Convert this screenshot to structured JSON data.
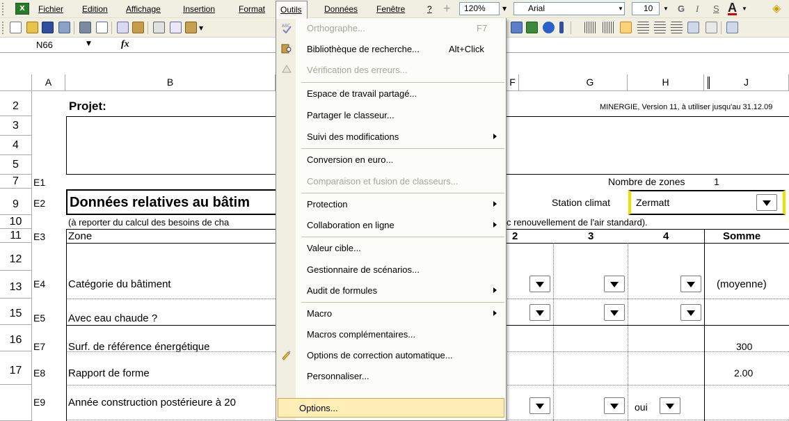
{
  "menubar": {
    "items": [
      "Fichier",
      "Edition",
      "Affichage",
      "Insertion",
      "Format",
      "Outils",
      "Données",
      "Fenêtre",
      "?"
    ],
    "zoom": "120%",
    "font_name": "Arial",
    "font_size": "10",
    "bold": "G",
    "italic": "I",
    "underline": "S"
  },
  "formula_bar": {
    "cell_ref": "N66",
    "fx": "fx"
  },
  "columns": [
    "A",
    "B",
    "F",
    "G",
    "H",
    "J"
  ],
  "rows": [
    "2",
    "3",
    "4",
    "5",
    "7",
    "9",
    "10",
    "11",
    "12",
    "13",
    "15",
    "16",
    "17"
  ],
  "sheet": {
    "project_label": "Projet:",
    "minergie": "MINERGIE, Version 11, à utiliser jusqu'au 31.12.09",
    "e1": "E1",
    "zones_label": "Nombre de zones",
    "zones_value": "1",
    "e2": "E2",
    "section_title": "Données relatives au bâtim",
    "station_label": "Station climat",
    "station_value": "Zermatt",
    "note_left": "(à reporter du calcul des besoins de cha",
    "note_right": "c renouvellement de l'air standard).",
    "e3": "E3",
    "zone_label": "Zone",
    "col2": "2",
    "col3": "3",
    "col4": "4",
    "sum": "Somme",
    "e4": "E4",
    "categorie": "Catégorie du bâtiment",
    "moyenne": "(moyenne)",
    "e5": "E5",
    "eau_chaude": "Avec eau chaude ?",
    "e7": "E7",
    "surf": "Surf. de référence énergétique",
    "surf_value": "300",
    "e8": "E8",
    "rapport": "Rapport de forme",
    "rapport_value": "2.00",
    "e9": "E9",
    "annee": "Année construction postérieure à 20",
    "oui": "oui"
  },
  "menu": {
    "items": [
      {
        "label": "Orthographe...",
        "shortcut": "F7",
        "disabled": true
      },
      {
        "label": "Bibliothèque de recherche...",
        "shortcut": "Alt+Click"
      },
      {
        "label": "Vérification des erreurs...",
        "disabled": true
      },
      {
        "label": "Espace de travail partagé..."
      },
      {
        "label": "Partager le classeur..."
      },
      {
        "label": "Suivi des modifications",
        "submenu": true
      },
      {
        "label": "Conversion en euro..."
      },
      {
        "label": "Comparaison et fusion de classeurs...",
        "disabled": true
      },
      {
        "label": "Protection",
        "submenu": true
      },
      {
        "label": "Collaboration en ligne",
        "submenu": true
      },
      {
        "label": "Valeur cible..."
      },
      {
        "label": "Gestionnaire de scénarios..."
      },
      {
        "label": "Audit de formules",
        "submenu": true
      },
      {
        "label": "Macro",
        "submenu": true
      },
      {
        "label": "Macros complémentaires..."
      },
      {
        "label": "Options de correction automatique..."
      },
      {
        "label": "Personnaliser..."
      },
      {
        "label": "Options...",
        "highlighted": true
      }
    ]
  },
  "colors": {
    "menu_highlight": "#ffeeb8",
    "menu_highlight_border": "#d0a840",
    "chrome": "#f1efe2",
    "station_border": "#f0e000"
  }
}
